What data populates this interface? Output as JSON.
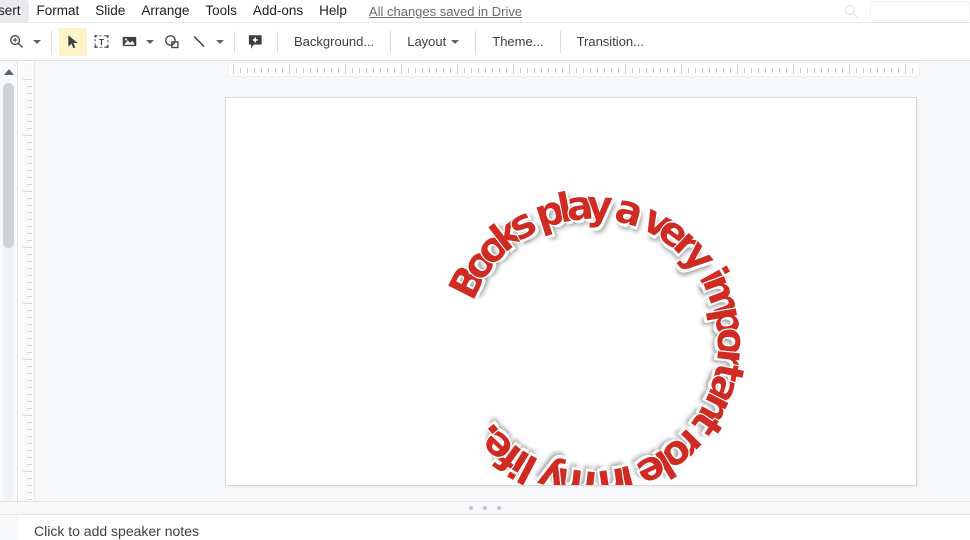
{
  "app": {
    "name": "Google Slides",
    "saved_state": "All changes saved in Drive"
  },
  "menubar": {
    "items": [
      {
        "label": "sert",
        "name": "menu-insert"
      },
      {
        "label": "Format",
        "name": "menu-format"
      },
      {
        "label": "Slide",
        "name": "menu-slide"
      },
      {
        "label": "Arrange",
        "name": "menu-arrange"
      },
      {
        "label": "Tools",
        "name": "menu-tools"
      },
      {
        "label": "Add-ons",
        "name": "menu-addons"
      },
      {
        "label": "Help",
        "name": "menu-help"
      }
    ]
  },
  "toolbar": {
    "icons": [
      {
        "name": "zoom-icon",
        "label": "Zoom"
      },
      {
        "name": "select-arrow-icon",
        "label": "Select"
      },
      {
        "name": "text-box-icon",
        "label": "Text box"
      },
      {
        "name": "image-icon",
        "label": "Image"
      },
      {
        "name": "shape-icon",
        "label": "Shape"
      },
      {
        "name": "line-icon",
        "label": "Line"
      },
      {
        "name": "add-comment-icon",
        "label": "Add comment"
      }
    ],
    "buttons": [
      {
        "label": "Background...",
        "name": "background-button",
        "caret": false
      },
      {
        "label": "Layout",
        "name": "layout-button",
        "caret": true
      },
      {
        "label": "Theme...",
        "name": "theme-button",
        "caret": false
      },
      {
        "label": "Transition...",
        "name": "transition-button",
        "caret": false
      }
    ]
  },
  "slide": {
    "wordart": {
      "text": "Books play a very important role in my life.",
      "fill_color": "#d02b22",
      "outline_color": "#ffffff",
      "shadow_color": "#5a5a5a",
      "shape": "arch-circle",
      "font_size_px": 40
    }
  },
  "notes": {
    "placeholder": "Click to add speaker notes"
  },
  "colors": {
    "canvas_bg": "#f7f8fa",
    "slide_bg": "#ffffff",
    "toolbar_active": "#fdf3c8",
    "text_primary": "#3c4043",
    "text_muted": "#6b6b6b"
  }
}
